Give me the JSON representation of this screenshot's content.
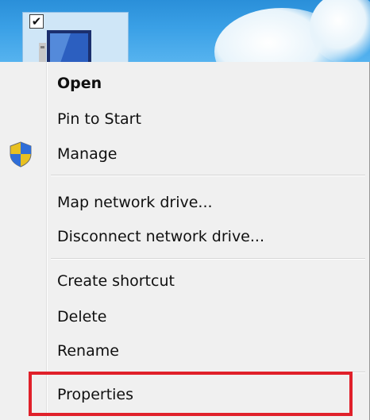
{
  "desktop": {
    "icon_checked_glyph": "✔"
  },
  "context_menu": {
    "items": [
      {
        "label": "Open"
      },
      {
        "label": "Pin to Start"
      },
      {
        "label": "Manage",
        "icon": "uac-shield-icon"
      },
      {
        "label": "Map network drive..."
      },
      {
        "label": "Disconnect network drive..."
      },
      {
        "label": "Create shortcut"
      },
      {
        "label": "Delete"
      },
      {
        "label": "Rename"
      },
      {
        "label": "Properties"
      }
    ]
  },
  "annotation": {
    "highlight_color": "#e0202a"
  }
}
